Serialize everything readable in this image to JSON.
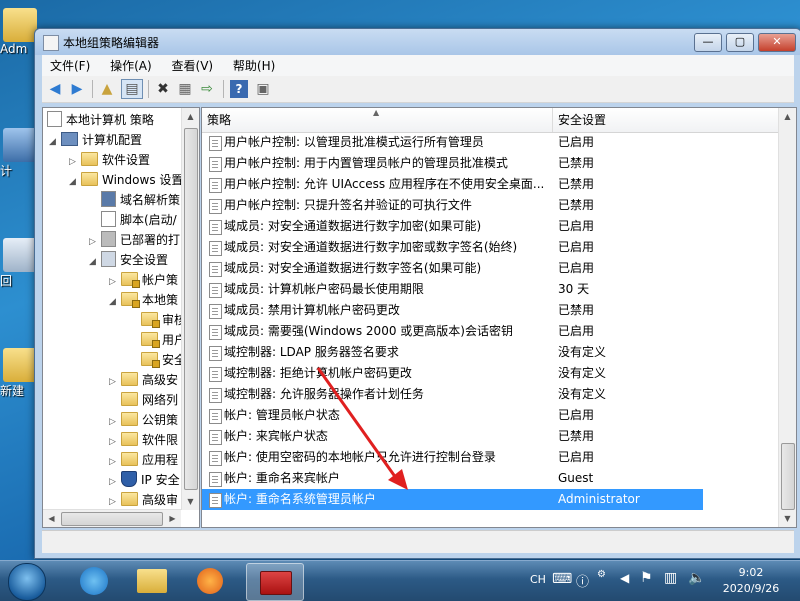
{
  "desktop": {
    "icons": [
      {
        "label": "Adm"
      },
      {
        "label": "计"
      },
      {
        "label": "回"
      },
      {
        "label": "新建"
      }
    ]
  },
  "window": {
    "title": "本地组策略编辑器",
    "controls": {
      "minimize": "—",
      "maximize": "▢",
      "close": "✕"
    }
  },
  "menu": [
    "文件(F)",
    "操作(A)",
    "查看(V)",
    "帮助(H)"
  ],
  "tree": {
    "items": [
      {
        "label": "本地计算机 策略",
        "arrow": ""
      },
      {
        "label": "计算机配置",
        "arrow": "◢"
      },
      {
        "label": "软件设置",
        "arrow": "▷"
      },
      {
        "label": "Windows 设置",
        "arrow": "◢"
      },
      {
        "label": "域名解析策",
        "arrow": ""
      },
      {
        "label": "脚本(启动/",
        "arrow": ""
      },
      {
        "label": "已部署的打",
        "arrow": "▷"
      },
      {
        "label": "安全设置",
        "arrow": "◢"
      },
      {
        "label": "帐户策",
        "arrow": "▷"
      },
      {
        "label": "本地策",
        "arrow": "◢"
      },
      {
        "label": "审核",
        "arrow": ""
      },
      {
        "label": "用户",
        "arrow": ""
      },
      {
        "label": "安全",
        "arrow": ""
      },
      {
        "label": "高级安",
        "arrow": "▷"
      },
      {
        "label": "网络列",
        "arrow": ""
      },
      {
        "label": "公钥策",
        "arrow": "▷"
      },
      {
        "label": "软件限",
        "arrow": "▷"
      },
      {
        "label": "应用程",
        "arrow": "▷"
      },
      {
        "label": "IP 安全",
        "arrow": "▷"
      },
      {
        "label": "高级审",
        "arrow": "▷"
      }
    ]
  },
  "list": {
    "columns": {
      "policy": "策略",
      "setting": "安全设置"
    },
    "rows": [
      {
        "policy": "用户帐户控制: 以管理员批准模式运行所有管理员",
        "setting": "已启用"
      },
      {
        "policy": "用户帐户控制: 用于内置管理员帐户的管理员批准模式",
        "setting": "已禁用"
      },
      {
        "policy": "用户帐户控制: 允许 UIAccess 应用程序在不使用安全桌面...",
        "setting": "已禁用"
      },
      {
        "policy": "用户帐户控制: 只提升签名并验证的可执行文件",
        "setting": "已禁用"
      },
      {
        "policy": "域成员: 对安全通道数据进行数字加密(如果可能)",
        "setting": "已启用"
      },
      {
        "policy": "域成员: 对安全通道数据进行数字加密或数字签名(始终)",
        "setting": "已启用"
      },
      {
        "policy": "域成员: 对安全通道数据进行数字签名(如果可能)",
        "setting": "已启用"
      },
      {
        "policy": "域成员: 计算机帐户密码最长使用期限",
        "setting": "30 天"
      },
      {
        "policy": "域成员: 禁用计算机帐户密码更改",
        "setting": "已禁用"
      },
      {
        "policy": "域成员: 需要强(Windows 2000 或更高版本)会话密钥",
        "setting": "已启用"
      },
      {
        "policy": "域控制器: LDAP 服务器签名要求",
        "setting": "没有定义"
      },
      {
        "policy": "域控制器: 拒绝计算机帐户密码更改",
        "setting": "没有定义"
      },
      {
        "policy": "域控制器: 允许服务器操作者计划任务",
        "setting": "没有定义"
      },
      {
        "policy": "帐户: 管理员帐户状态",
        "setting": "已启用"
      },
      {
        "policy": "帐户: 来宾帐户状态",
        "setting": "已禁用"
      },
      {
        "policy": "帐户: 使用空密码的本地帐户只允许进行控制台登录",
        "setting": "已启用"
      },
      {
        "policy": "帐户: 重命名来宾帐户",
        "setting": "Guest"
      },
      {
        "policy": "帐户: 重命名系统管理员帐户",
        "setting": "Administrator"
      }
    ]
  },
  "taskbar": {
    "tray": {
      "lang": "CH"
    },
    "clock": {
      "time": "9:02",
      "date": "2020/9/26"
    }
  },
  "colors": {
    "selection": "#3399ff",
    "arrow": "#e02020"
  }
}
